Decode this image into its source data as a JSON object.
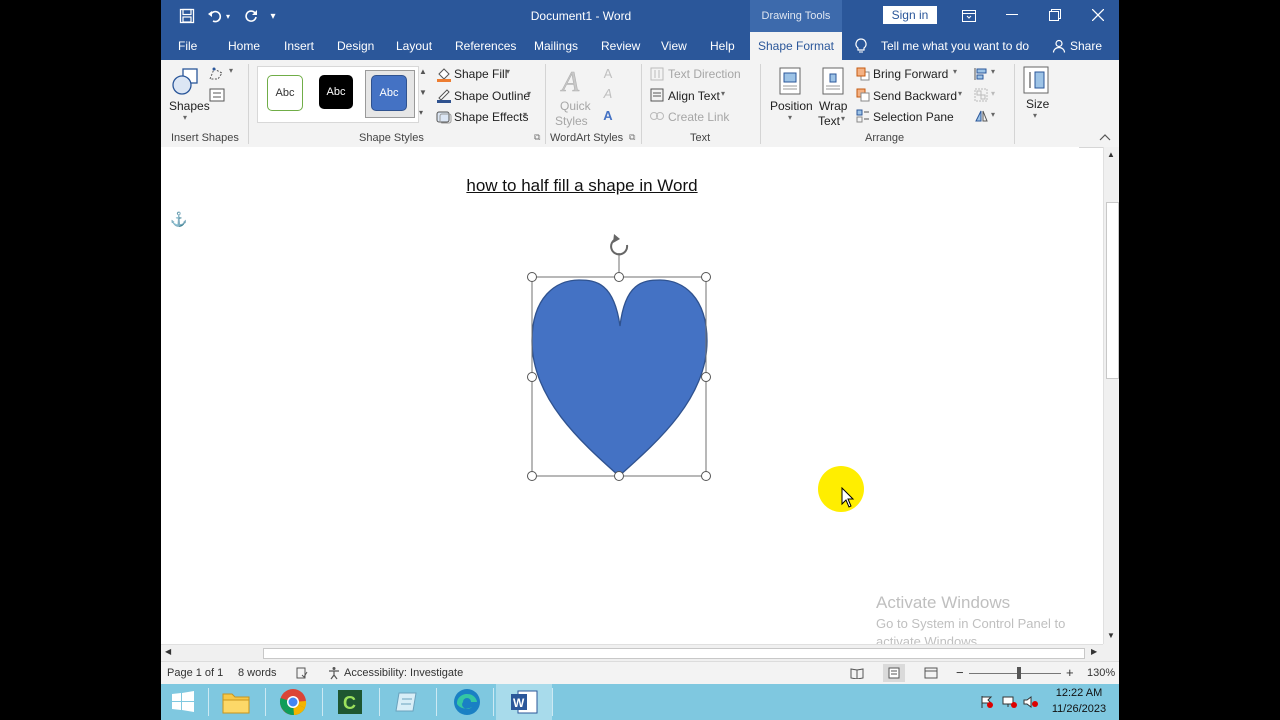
{
  "window": {
    "title": "Document1  -  Word",
    "context_tab_group": "Drawing Tools",
    "sign_in": "Sign in"
  },
  "tabs": [
    "File",
    "Home",
    "Insert",
    "Design",
    "Layout",
    "References",
    "Mailings",
    "Review",
    "View",
    "Help",
    "Shape Format"
  ],
  "active_tab": "Shape Format",
  "tell_me": "Tell me what you want to do",
  "share": "Share",
  "ribbon": {
    "insert_shapes": {
      "shapes_label": "Shapes",
      "group_label": "Insert Shapes"
    },
    "shape_styles": {
      "samples": [
        "Abc",
        "Abc",
        "Abc"
      ],
      "fill": "Shape Fill",
      "outline": "Shape Outline",
      "effects": "Shape Effects",
      "group_label": "Shape Styles"
    },
    "wordart": {
      "quick_styles_1": "Quick",
      "quick_styles_2": "Styles",
      "group_label": "WordArt Styles"
    },
    "text": {
      "text_direction": "Text Direction",
      "align_text": "Align Text",
      "create_link": "Create Link",
      "group_label": "Text"
    },
    "arrange": {
      "position": "Position",
      "wrap_1": "Wrap",
      "wrap_2": "Text",
      "bring_forward": "Bring Forward",
      "send_backward": "Send Backward",
      "selection_pane": "Selection Pane",
      "group_label": "Arrange"
    },
    "size": {
      "label": "Size"
    }
  },
  "document": {
    "heading": "how to half fill a shape in Word",
    "shape_fill_color": "#4472c4",
    "shape_outline_color": "#2f528f"
  },
  "status": {
    "page": "Page 1 of 1",
    "words": "8 words",
    "accessibility": "Accessibility: Investigate",
    "zoom": "130%"
  },
  "watermark": {
    "title": "Activate Windows",
    "line1": "Go to System in Control Panel to",
    "line2": "activate Windows."
  },
  "taskbar": {
    "time": "12:22 AM",
    "date": "11/26/2023"
  },
  "colors": {
    "word_blue": "#2b579a",
    "taskbar": "#7fc8e0",
    "cursor_highlight": "#ffee00"
  }
}
